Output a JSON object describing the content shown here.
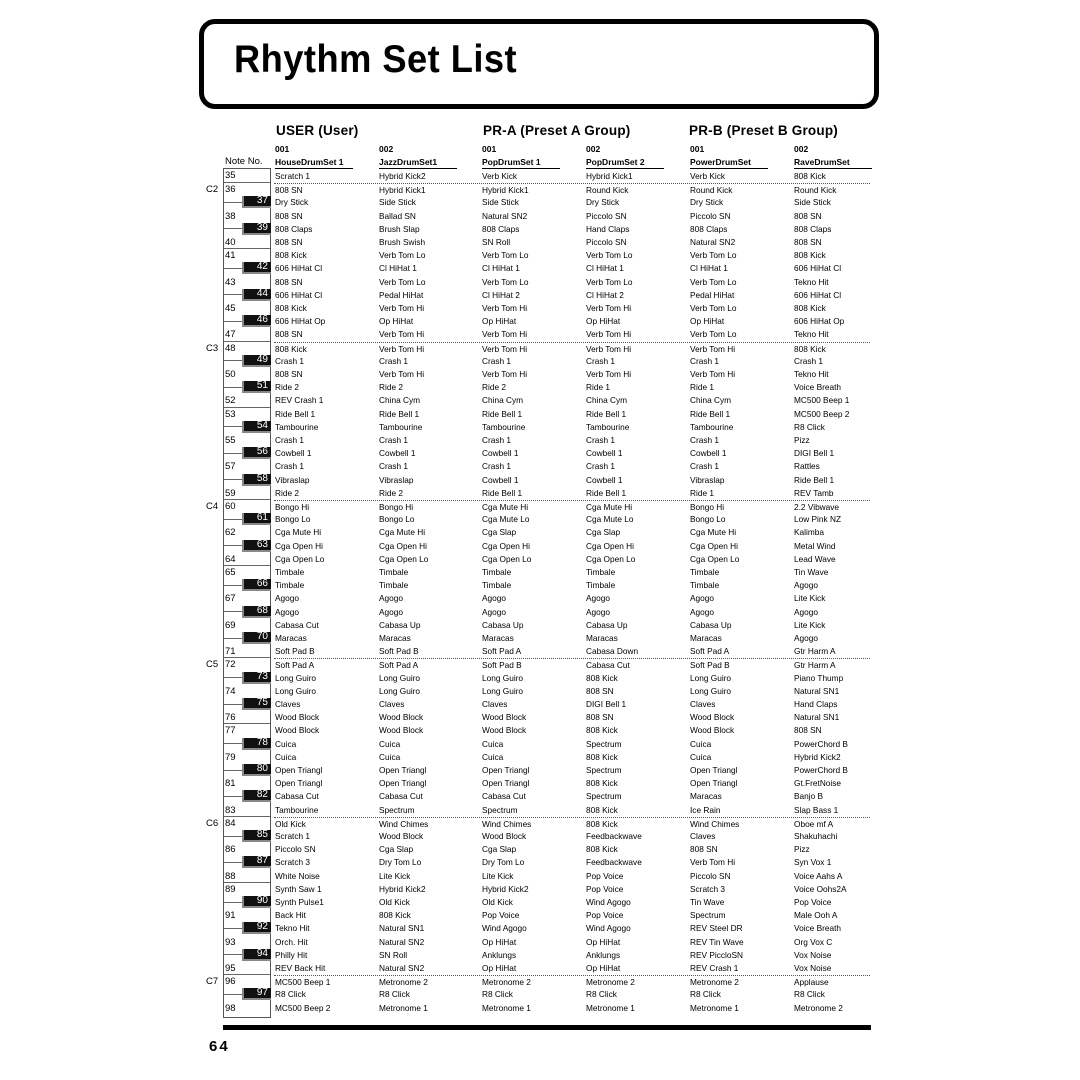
{
  "title": "Rhythm Set List",
  "page_number": "64",
  "note_label": "Note No.",
  "groups": [
    {
      "label": "USER (User)"
    },
    {
      "label": "PR-A (Preset A Group)"
    },
    {
      "label": "PR-B (Preset B Group)"
    }
  ],
  "columns": [
    {
      "num": "001",
      "name": "HouseDrumSet 1"
    },
    {
      "num": "002",
      "name": "JazzDrumSet1"
    },
    {
      "num": "001",
      "name": "PopDrumSet 1"
    },
    {
      "num": "002",
      "name": "PopDrumSet 2"
    },
    {
      "num": "001",
      "name": "PowerDrumSet"
    },
    {
      "num": "002",
      "name": "RaveDrumSet"
    }
  ],
  "octaves": [
    {
      "label": "C2",
      "note": 36
    },
    {
      "label": "C3",
      "note": 48
    },
    {
      "label": "C4",
      "note": 60
    },
    {
      "label": "C5",
      "note": 72
    },
    {
      "label": "C6",
      "note": 84
    },
    {
      "label": "C7",
      "note": 96
    }
  ],
  "rows": [
    {
      "note": "35",
      "cells": [
        "Scratch 1",
        "Hybrid Kick2",
        "Verb Kick",
        "Hybrid Kick1",
        "Verb Kick",
        "808 Kick"
      ]
    },
    {
      "note": "36",
      "cells": [
        "808 SN",
        "Hybrid Kick1",
        "Hybrid Kick1",
        "Round Kick",
        "Round Kick",
        "Round Kick"
      ]
    },
    {
      "note": "37",
      "cells": [
        "Dry Stick",
        "Side Stick",
        "Side Stick",
        "Dry Stick",
        "Dry Stick",
        "Side Stick"
      ]
    },
    {
      "note": "38",
      "cells": [
        "808 SN",
        "Ballad SN",
        "Natural SN2",
        "Piccolo SN",
        "Piccolo SN",
        "808 SN"
      ]
    },
    {
      "note": "39",
      "cells": [
        "808 Claps",
        "Brush Slap",
        "808 Claps",
        "Hand Claps",
        "808 Claps",
        "808 Claps"
      ]
    },
    {
      "note": "40",
      "cells": [
        "808 SN",
        "Brush Swish",
        "SN Roll",
        "Piccolo SN",
        "Natural SN2",
        "808 SN"
      ]
    },
    {
      "note": "41",
      "cells": [
        "808 Kick",
        "Verb Tom Lo",
        "Verb Tom Lo",
        "Verb Tom Lo",
        "Verb Tom Lo",
        "808 Kick"
      ]
    },
    {
      "note": "42",
      "cells": [
        "606 HiHat Cl",
        "Cl HiHat 1",
        "Cl HiHat 1",
        "Cl HiHat 1",
        "Cl HiHat 1",
        "606 HiHat Cl"
      ]
    },
    {
      "note": "43",
      "cells": [
        "808 SN",
        "Verb Tom Lo",
        "Verb Tom Lo",
        "Verb Tom Lo",
        "Verb Tom Lo",
        "Tekno Hit"
      ]
    },
    {
      "note": "44",
      "cells": [
        "606 HiHat Cl",
        "Pedal HiHat",
        "Cl HiHat 2",
        "Cl HiHat 2",
        "Pedal HiHat",
        "606 HiHat Cl"
      ]
    },
    {
      "note": "45",
      "cells": [
        "808 Kick",
        "Verb Tom Hi",
        "Verb Tom Hi",
        "Verb Tom Hi",
        "Verb Tom Lo",
        "808 Kick"
      ]
    },
    {
      "note": "46",
      "cells": [
        "606 HiHat Op",
        "Op HiHat",
        "Op HiHat",
        "Op HiHat",
        "Op HiHat",
        "606 HiHat Op"
      ]
    },
    {
      "note": "47",
      "cells": [
        "808 SN",
        "Verb Tom Hi",
        "Verb Tom Hi",
        "Verb Tom Hi",
        "Verb Tom Lo",
        "Tekno Hit"
      ]
    },
    {
      "note": "48",
      "cells": [
        "808 Kick",
        "Verb Tom Hi",
        "Verb Tom Hi",
        "Verb Tom Hi",
        "Verb Tom Hi",
        "808 Kick"
      ]
    },
    {
      "note": "49",
      "cells": [
        "Crash 1",
        "Crash 1",
        "Crash 1",
        "Crash 1",
        "Crash 1",
        "Crash 1"
      ]
    },
    {
      "note": "50",
      "cells": [
        "808 SN",
        "Verb Tom Hi",
        "Verb Tom Hi",
        "Verb Tom Hi",
        "Verb Tom Hi",
        "Tekno Hit"
      ]
    },
    {
      "note": "51",
      "cells": [
        "Ride 2",
        "Ride 2",
        "Ride 2",
        "Ride 1",
        "Ride 1",
        "Voice Breath"
      ]
    },
    {
      "note": "52",
      "cells": [
        "REV Crash 1",
        "China Cym",
        "China Cym",
        "China Cym",
        "China Cym",
        "MC500 Beep 1"
      ]
    },
    {
      "note": "53",
      "cells": [
        "Ride Bell 1",
        "Ride Bell 1",
        "Ride Bell 1",
        "Ride Bell 1",
        "Ride Bell 1",
        "MC500 Beep 2"
      ]
    },
    {
      "note": "54",
      "cells": [
        "Tambourine",
        "Tambourine",
        "Tambourine",
        "Tambourine",
        "Tambourine",
        "R8 Click"
      ]
    },
    {
      "note": "55",
      "cells": [
        "Crash 1",
        "Crash 1",
        "Crash 1",
        "Crash 1",
        "Crash 1",
        "Pizz"
      ]
    },
    {
      "note": "56",
      "cells": [
        "Cowbell 1",
        "Cowbell 1",
        "Cowbell 1",
        "Cowbell 1",
        "Cowbell 1",
        "DIGI Bell 1"
      ]
    },
    {
      "note": "57",
      "cells": [
        "Crash 1",
        "Crash 1",
        "Crash 1",
        "Crash 1",
        "Crash 1",
        "Rattles"
      ]
    },
    {
      "note": "58",
      "cells": [
        "Vibraslap",
        "Vibraslap",
        "Cowbell 1",
        "Cowbell 1",
        "Vibraslap",
        "Ride Bell 1"
      ]
    },
    {
      "note": "59",
      "cells": [
        "Ride 2",
        "Ride 2",
        "Ride Bell 1",
        "Ride Bell 1",
        "Ride 1",
        "REV Tamb"
      ]
    },
    {
      "note": "60",
      "cells": [
        "Bongo Hi",
        "Bongo Hi",
        "Cga Mute Hi",
        "Cga Mute Hi",
        "Bongo Hi",
        "2.2 Vibwave"
      ]
    },
    {
      "note": "61",
      "cells": [
        "Bongo Lo",
        "Bongo Lo",
        "Cga Mute Lo",
        "Cga Mute Lo",
        "Bongo Lo",
        "Low Pink NZ"
      ]
    },
    {
      "note": "62",
      "cells": [
        "Cga Mute Hi",
        "Cga Mute Hi",
        "Cga Slap",
        "Cga Slap",
        "Cga Mute Hi",
        "Kalimba"
      ]
    },
    {
      "note": "63",
      "cells": [
        "Cga Open Hi",
        "Cga Open Hi",
        "Cga Open Hi",
        "Cga Open Hi",
        "Cga Open Hi",
        "Metal Wind"
      ]
    },
    {
      "note": "64",
      "cells": [
        "Cga Open Lo",
        "Cga Open Lo",
        "Cga Open Lo",
        "Cga Open Lo",
        "Cga Open Lo",
        "Lead Wave"
      ]
    },
    {
      "note": "65",
      "cells": [
        "Timbale",
        "Timbale",
        "Timbale",
        "Timbale",
        "Timbale",
        "Tin Wave"
      ]
    },
    {
      "note": "66",
      "cells": [
        "Timbale",
        "Timbale",
        "Timbale",
        "Timbale",
        "Timbale",
        "Agogo"
      ]
    },
    {
      "note": "67",
      "cells": [
        "Agogo",
        "Agogo",
        "Agogo",
        "Agogo",
        "Agogo",
        "Lite Kick"
      ]
    },
    {
      "note": "68",
      "cells": [
        "Agogo",
        "Agogo",
        "Agogo",
        "Agogo",
        "Agogo",
        "Agogo"
      ]
    },
    {
      "note": "69",
      "cells": [
        "Cabasa Cut",
        "Cabasa Up",
        "Cabasa Up",
        "Cabasa Up",
        "Cabasa Up",
        "Lite Kick"
      ]
    },
    {
      "note": "70",
      "cells": [
        "Maracas",
        "Maracas",
        "Maracas",
        "Maracas",
        "Maracas",
        "Agogo"
      ]
    },
    {
      "note": "71",
      "cells": [
        "Soft Pad B",
        "Soft Pad B",
        "Soft Pad A",
        "Cabasa Down",
        "Soft Pad A",
        "Gtr Harm A"
      ]
    },
    {
      "note": "72",
      "cells": [
        "Soft Pad A",
        "Soft Pad A",
        "Soft Pad B",
        "Cabasa Cut",
        "Soft Pad B",
        "Gtr Harm A"
      ]
    },
    {
      "note": "73",
      "cells": [
        "Long Guiro",
        "Long Guiro",
        "Long Guiro",
        "808 Kick",
        "Long Guiro",
        "Piano Thump"
      ]
    },
    {
      "note": "74",
      "cells": [
        "Long Guiro",
        "Long Guiro",
        "Long Guiro",
        "808 SN",
        "Long Guiro",
        "Natural SN1"
      ]
    },
    {
      "note": "75",
      "cells": [
        "Claves",
        "Claves",
        "Claves",
        "DIGI Bell 1",
        "Claves",
        "Hand Claps"
      ]
    },
    {
      "note": "76",
      "cells": [
        "Wood Block",
        "Wood Block",
        "Wood Block",
        "808 SN",
        "Wood Block",
        "Natural SN1"
      ]
    },
    {
      "note": "77",
      "cells": [
        "Wood Block",
        "Wood Block",
        "Wood Block",
        "808 Kick",
        "Wood Block",
        "808 SN"
      ]
    },
    {
      "note": "78",
      "cells": [
        "Cuica",
        "Cuica",
        "Cuica",
        "Spectrum",
        "Cuica",
        "PowerChord B"
      ]
    },
    {
      "note": "79",
      "cells": [
        "Cuica",
        "Cuica",
        "Cuica",
        "808 Kick",
        "Cuica",
        "Hybrid Kick2"
      ]
    },
    {
      "note": "80",
      "cells": [
        "Open Triangl",
        "Open Triangl",
        "Open Triangl",
        "Spectrum",
        "Open Triangl",
        "PowerChord B"
      ]
    },
    {
      "note": "81",
      "cells": [
        "Open Triangl",
        "Open Triangl",
        "Open Triangl",
        "808 Kick",
        "Open Triangl",
        "Gt.FretNoise"
      ]
    },
    {
      "note": "82",
      "cells": [
        "Cabasa Cut",
        "Cabasa Cut",
        "Cabasa Cut",
        "Spectrum",
        "Maracas",
        "Banjo B"
      ]
    },
    {
      "note": "83",
      "cells": [
        "Tambourine",
        "Spectrum",
        "Spectrum",
        "808 Kick",
        "Ice Rain",
        "Slap Bass 1"
      ]
    },
    {
      "note": "84",
      "cells": [
        "Old Kick",
        "Wind Chimes",
        "Wind Chimes",
        "808 Kick",
        "Wind Chimes",
        "Oboe mf A"
      ]
    },
    {
      "note": "85",
      "cells": [
        "Scratch 1",
        "Wood Block",
        "Wood Block",
        "Feedbackwave",
        "Claves",
        "Shakuhachi"
      ]
    },
    {
      "note": "86",
      "cells": [
        "Piccolo SN",
        "Cga Slap",
        "Cga Slap",
        "808 Kick",
        "808 SN",
        "Pizz"
      ]
    },
    {
      "note": "87",
      "cells": [
        "Scratch 3",
        "Dry Tom Lo",
        "Dry Tom Lo",
        "Feedbackwave",
        "Verb Tom Hi",
        "Syn Vox 1"
      ]
    },
    {
      "note": "88",
      "cells": [
        "White Noise",
        "Lite Kick",
        "Lite Kick",
        "Pop Voice",
        "Piccolo SN",
        "Voice Aahs A"
      ]
    },
    {
      "note": "89",
      "cells": [
        "Synth Saw 1",
        "Hybrid Kick2",
        "Hybrid Kick2",
        "Pop Voice",
        "Scratch 3",
        "Voice Oohs2A"
      ]
    },
    {
      "note": "90",
      "cells": [
        "Synth Pulse1",
        "Old Kick",
        "Old Kick",
        "Wind Agogo",
        "Tin Wave",
        "Pop Voice"
      ]
    },
    {
      "note": "91",
      "cells": [
        "Back Hit",
        "808 Kick",
        "Pop Voice",
        "Pop Voice",
        "Spectrum",
        "Male Ooh A"
      ]
    },
    {
      "note": "92",
      "cells": [
        "Tekno Hit",
        "Natural SN1",
        "Wind Agogo",
        "Wind Agogo",
        "REV Steel DR",
        "Voice Breath"
      ]
    },
    {
      "note": "93",
      "cells": [
        "Orch. Hit",
        "Natural SN2",
        "Op HiHat",
        "Op HiHat",
        "REV Tin Wave",
        "Org Vox C"
      ]
    },
    {
      "note": "94",
      "cells": [
        "Philly Hit",
        "SN Roll",
        "Anklungs",
        "Anklungs",
        "REV PiccloSN",
        "Vox Noise"
      ]
    },
    {
      "note": "95",
      "cells": [
        "REV Back Hit",
        "Natural SN2",
        "Op HiHat",
        "Op HiHat",
        "REV Crash 1",
        "Vox Noise"
      ]
    },
    {
      "note": "96",
      "cells": [
        "MC500 Beep 1",
        "Metronome 2",
        "Metronome 2",
        "Metronome 2",
        "Metronome 2",
        "Applause"
      ]
    },
    {
      "note": "97",
      "cells": [
        "R8 Click",
        "R8 Click",
        "R8 Click",
        "R8 Click",
        "R8 Click",
        "R8 Click"
      ]
    },
    {
      "note": "98",
      "cells": [
        "MC500 Beep 2",
        "Metronome 1",
        "Metronome 1",
        "Metronome 1",
        "Metronome 1",
        "Metronome 2"
      ]
    }
  ]
}
